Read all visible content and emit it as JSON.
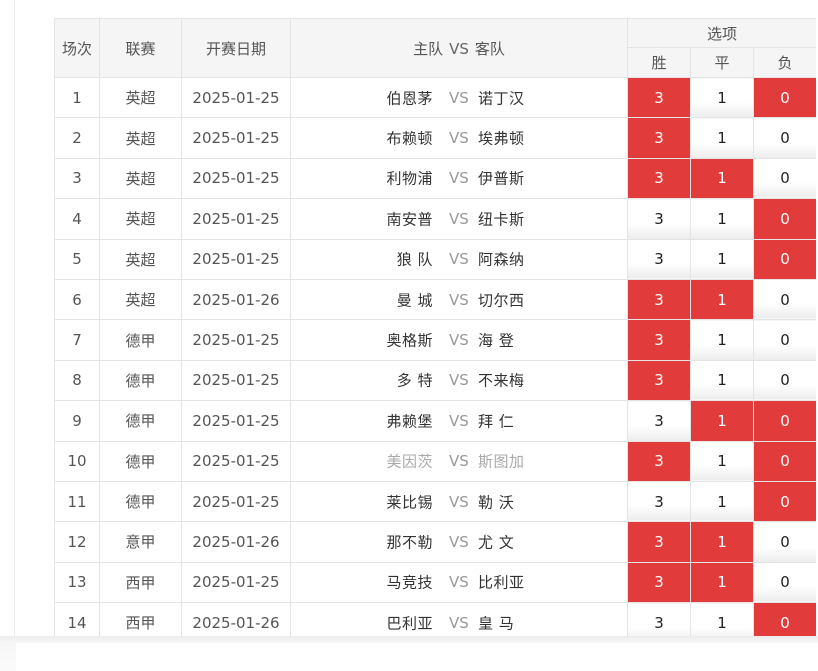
{
  "header": {
    "col_num": "场次",
    "col_league": "联赛",
    "col_date": "开赛日期",
    "col_home": "主队",
    "col_vs": "VS",
    "col_away": "客队",
    "col_options": "选项",
    "opt_win": "胜",
    "opt_draw": "平",
    "opt_lose": "负"
  },
  "colors": {
    "selected": "#e23b3b",
    "vs_text": "#999999",
    "muted_team": "#aaaaaa"
  },
  "rows": [
    {
      "num": "1",
      "league": "英超",
      "date": "2025-01-25",
      "home": "伯恩茅",
      "vs": "VS",
      "away": "诺丁汉",
      "muted": false,
      "win": "3",
      "draw": "1",
      "lose": "0",
      "win_sel": true,
      "draw_sel": false,
      "lose_sel": true
    },
    {
      "num": "2",
      "league": "英超",
      "date": "2025-01-25",
      "home": "布赖顿",
      "vs": "VS",
      "away": "埃弗顿",
      "muted": false,
      "win": "3",
      "draw": "1",
      "lose": "0",
      "win_sel": true,
      "draw_sel": false,
      "lose_sel": false
    },
    {
      "num": "3",
      "league": "英超",
      "date": "2025-01-25",
      "home": "利物浦",
      "vs": "VS",
      "away": "伊普斯",
      "muted": false,
      "win": "3",
      "draw": "1",
      "lose": "0",
      "win_sel": true,
      "draw_sel": true,
      "lose_sel": false
    },
    {
      "num": "4",
      "league": "英超",
      "date": "2025-01-25",
      "home": "南安普",
      "vs": "VS",
      "away": "纽卡斯",
      "muted": false,
      "win": "3",
      "draw": "1",
      "lose": "0",
      "win_sel": false,
      "draw_sel": false,
      "lose_sel": true
    },
    {
      "num": "5",
      "league": "英超",
      "date": "2025-01-25",
      "home": "狼 队",
      "vs": "VS",
      "away": "阿森纳",
      "muted": false,
      "win": "3",
      "draw": "1",
      "lose": "0",
      "win_sel": false,
      "draw_sel": false,
      "lose_sel": true
    },
    {
      "num": "6",
      "league": "英超",
      "date": "2025-01-26",
      "home": "曼 城",
      "vs": "VS",
      "away": "切尔西",
      "muted": false,
      "win": "3",
      "draw": "1",
      "lose": "0",
      "win_sel": true,
      "draw_sel": true,
      "lose_sel": false
    },
    {
      "num": "7",
      "league": "德甲",
      "date": "2025-01-25",
      "home": "奥格斯",
      "vs": "VS",
      "away": "海 登",
      "muted": false,
      "win": "3",
      "draw": "1",
      "lose": "0",
      "win_sel": true,
      "draw_sel": false,
      "lose_sel": false
    },
    {
      "num": "8",
      "league": "德甲",
      "date": "2025-01-25",
      "home": "多 特",
      "vs": "VS",
      "away": "不来梅",
      "muted": false,
      "win": "3",
      "draw": "1",
      "lose": "0",
      "win_sel": true,
      "draw_sel": false,
      "lose_sel": false
    },
    {
      "num": "9",
      "league": "德甲",
      "date": "2025-01-25",
      "home": "弗赖堡",
      "vs": "VS",
      "away": "拜 仁",
      "muted": false,
      "win": "3",
      "draw": "1",
      "lose": "0",
      "win_sel": false,
      "draw_sel": true,
      "lose_sel": true
    },
    {
      "num": "10",
      "league": "德甲",
      "date": "2025-01-25",
      "home": "美因茨",
      "vs": "VS",
      "away": "斯图加",
      "muted": true,
      "win": "3",
      "draw": "1",
      "lose": "0",
      "win_sel": true,
      "draw_sel": false,
      "lose_sel": true
    },
    {
      "num": "11",
      "league": "德甲",
      "date": "2025-01-25",
      "home": "莱比锡",
      "vs": "VS",
      "away": "勒 沃",
      "muted": false,
      "win": "3",
      "draw": "1",
      "lose": "0",
      "win_sel": false,
      "draw_sel": false,
      "lose_sel": true
    },
    {
      "num": "12",
      "league": "意甲",
      "date": "2025-01-26",
      "home": "那不勒",
      "vs": "VS",
      "away": "尤 文",
      "muted": false,
      "win": "3",
      "draw": "1",
      "lose": "0",
      "win_sel": true,
      "draw_sel": true,
      "lose_sel": false
    },
    {
      "num": "13",
      "league": "西甲",
      "date": "2025-01-25",
      "home": "马竞技",
      "vs": "VS",
      "away": "比利亚",
      "muted": false,
      "win": "3",
      "draw": "1",
      "lose": "0",
      "win_sel": true,
      "draw_sel": true,
      "lose_sel": false
    },
    {
      "num": "14",
      "league": "西甲",
      "date": "2025-01-26",
      "home": "巴利亚",
      "vs": "VS",
      "away": "皇 马",
      "muted": false,
      "win": "3",
      "draw": "1",
      "lose": "0",
      "win_sel": false,
      "draw_sel": false,
      "lose_sel": true
    }
  ]
}
